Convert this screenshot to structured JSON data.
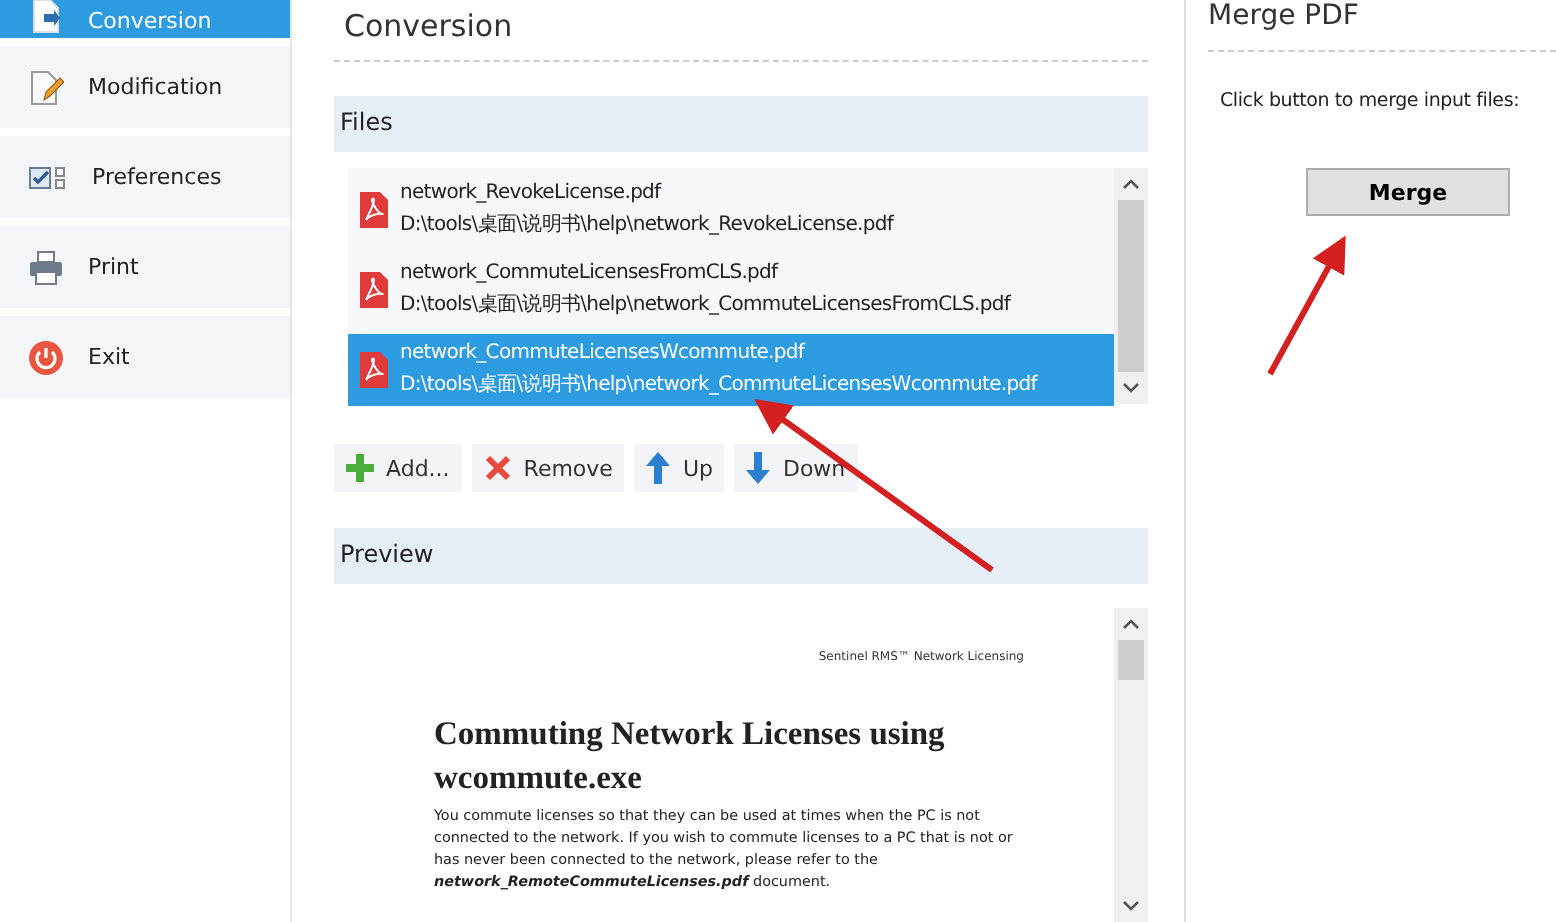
{
  "sidebar": {
    "items": [
      {
        "label": "Conversion",
        "kind": "convert",
        "selected": true
      },
      {
        "label": "Modification",
        "kind": "edit",
        "selected": false
      },
      {
        "label": "Preferences",
        "kind": "prefs",
        "selected": false
      },
      {
        "label": "Print",
        "kind": "print",
        "selected": false
      },
      {
        "label": "Exit",
        "kind": "exit",
        "selected": false
      }
    ]
  },
  "main": {
    "title": "Conversion",
    "files": {
      "header": "Files",
      "items": [
        {
          "name": "network_RevokeLicense.pdf",
          "path": "D:\\tools\\桌面\\说明书\\help\\network_RevokeLicense.pdf",
          "selected": false
        },
        {
          "name": "network_CommuteLicensesFromCLS.pdf",
          "path": "D:\\tools\\桌面\\说明书\\help\\network_CommuteLicensesFromCLS.pdf",
          "selected": false
        },
        {
          "name": "network_CommuteLicensesWcommute.pdf",
          "path": "D:\\tools\\桌面\\说明书\\help\\network_CommuteLicensesWcommute.pdf",
          "selected": true
        }
      ],
      "buttons": [
        {
          "label": "Add...",
          "kind": "add"
        },
        {
          "label": "Remove",
          "kind": "remove"
        },
        {
          "label": "Up",
          "kind": "up"
        },
        {
          "label": "Down",
          "kind": "down"
        }
      ]
    },
    "preview": {
      "header": "Preview",
      "running_header": "Sentinel RMS™ Network Licensing",
      "heading": "Commuting Network Licenses using wcommute.exe",
      "paragraph": "You commute licenses so that they can be used at times when the PC is not connected to the network.  If you wish to commute licenses to a PC that is not or has never been connected to the network, please refer to the **network_RemoteCommuteLicenses.pdf** document."
    }
  },
  "merge_panel": {
    "title": "Merge PDF",
    "instruction": "Click button to merge input files:",
    "button": "Merge"
  }
}
